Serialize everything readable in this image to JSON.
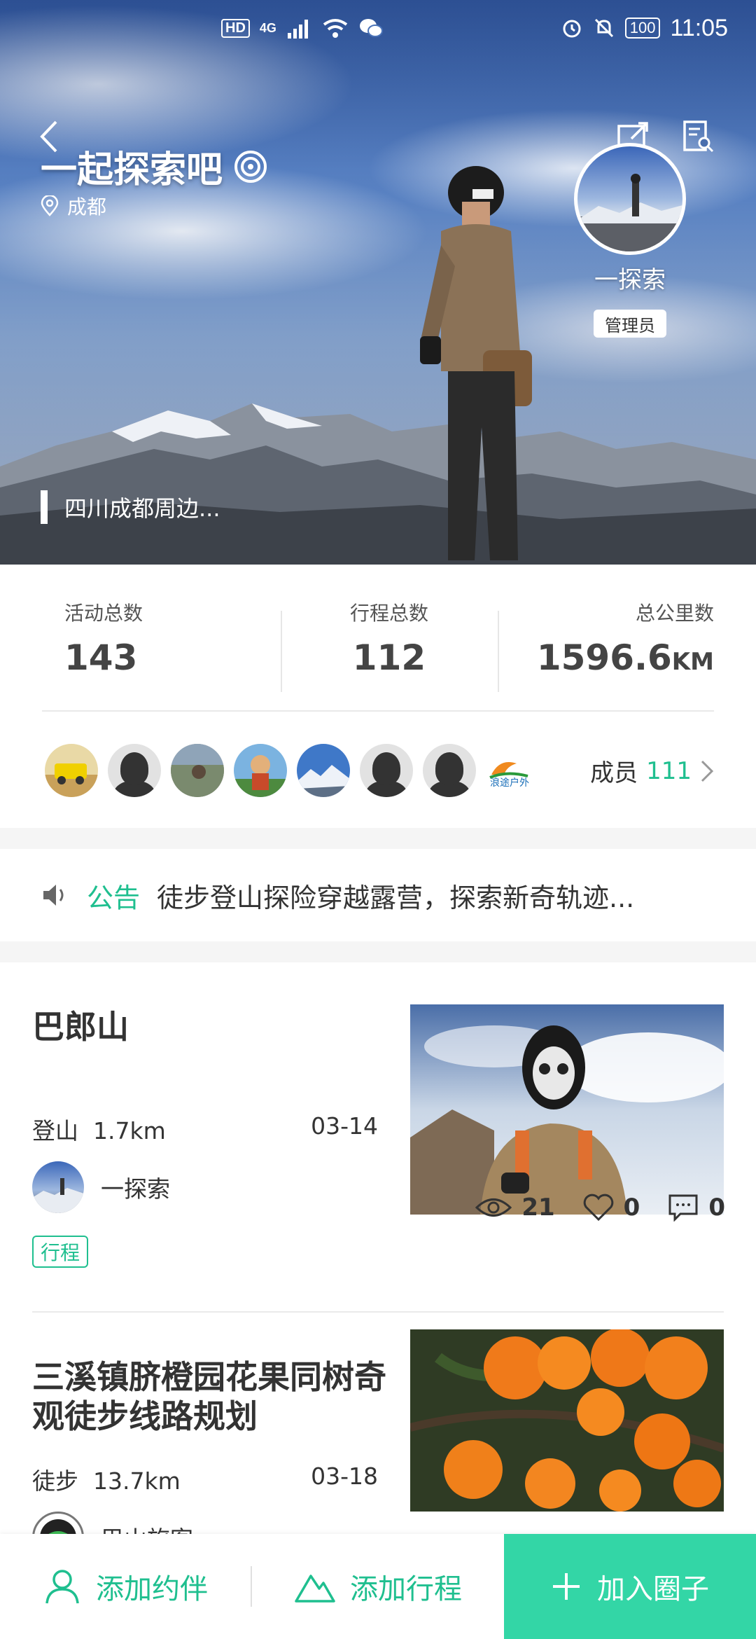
{
  "status_bar": {
    "network_badge": "HD",
    "network_type": "4G",
    "battery": "100",
    "time": "11:05"
  },
  "header": {
    "title": "一起探索吧",
    "location": "成都",
    "admin_name": "一探索",
    "admin_badge": "管理员",
    "description": "四川成都周边..."
  },
  "stats": {
    "activities_label": "活动总数",
    "activities_value": "143",
    "trips_label": "行程总数",
    "trips_value": "112",
    "distance_label": "总公里数",
    "distance_value": "1596.6",
    "distance_unit": "KM"
  },
  "members": {
    "label": "成员",
    "count": "111",
    "logo_text": "浪途户外"
  },
  "notice": {
    "tag": "公告",
    "text": "徒步登山探险穿越露营，探索新奇轨迹..."
  },
  "feed": [
    {
      "title": "巴郎山",
      "type": "登山",
      "distance": "1.7km",
      "date": "03-14",
      "author": "一探索",
      "tag": "行程",
      "views": "21",
      "likes": "0",
      "comments": "0"
    },
    {
      "title": "三溪镇脐橙园花果同树奇观徒步线路规划",
      "type": "徒步",
      "distance": "13.7km",
      "date": "03-18",
      "author": "巴山旅客"
    }
  ],
  "bottom_bar": {
    "add_partner": "添加约伴",
    "add_trip": "添加行程",
    "join": "加入圈子"
  },
  "colors": {
    "accent": "#1fbf8f",
    "join_button": "#33d6a6"
  }
}
